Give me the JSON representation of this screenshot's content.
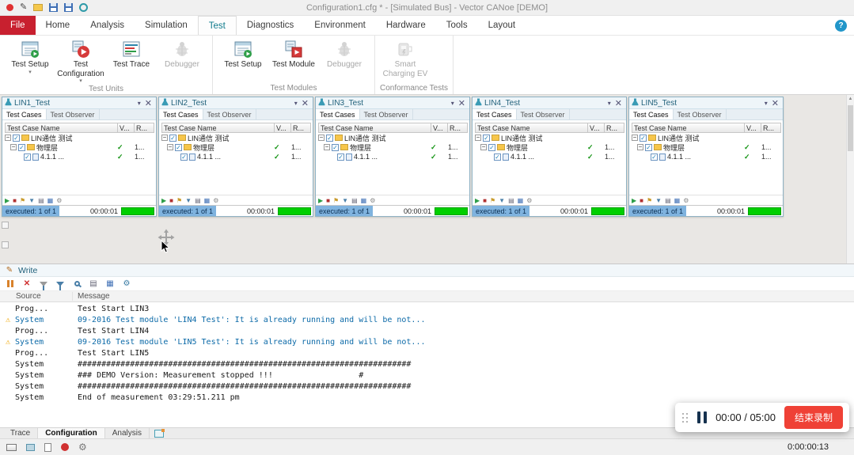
{
  "titlebar": {
    "title": "Configuration1.cfg * - [Simulated Bus] - Vector CANoe [DEMO]"
  },
  "menu": {
    "tabs": [
      "File",
      "Home",
      "Analysis",
      "Simulation",
      "Test",
      "Diagnostics",
      "Environment",
      "Hardware",
      "Tools",
      "Layout"
    ],
    "active": "Test",
    "help_label": "?"
  },
  "ribbon": {
    "groups": [
      {
        "label": "Test Units",
        "items": [
          {
            "label": "Test Setup",
            "dropdown": true,
            "enabled": true,
            "icon": "test-setup"
          },
          {
            "label": "Test Configuration",
            "dropdown": true,
            "enabled": true,
            "icon": "test-configuration"
          },
          {
            "label": "Test Trace",
            "dropdown": false,
            "enabled": true,
            "icon": "test-trace"
          },
          {
            "label": "Debugger",
            "dropdown": false,
            "enabled": false,
            "icon": "debugger"
          }
        ]
      },
      {
        "label": "Test Modules",
        "items": [
          {
            "label": "Test Setup",
            "dropdown": false,
            "enabled": true,
            "icon": "test-setup"
          },
          {
            "label": "Test Module",
            "dropdown": false,
            "enabled": true,
            "icon": "test-module"
          },
          {
            "label": "Debugger",
            "dropdown": false,
            "enabled": false,
            "icon": "debugger"
          }
        ]
      },
      {
        "label": "Conformance Tests",
        "items": [
          {
            "label": "Smart Charging EV",
            "dropdown": false,
            "enabled": false,
            "icon": "smart-charging"
          }
        ]
      }
    ]
  },
  "test_windows": [
    {
      "title": "LIN1_Test"
    },
    {
      "title": "LIN2_Test"
    },
    {
      "title": "LIN3_Test"
    },
    {
      "title": "LIN4_Test"
    },
    {
      "title": "LIN5_Test"
    }
  ],
  "test_window": {
    "tabs": [
      "Test Cases",
      "Test Observer"
    ],
    "active_tab": "Test Cases",
    "columns": [
      "Test Case Name",
      "V...",
      "R..."
    ],
    "rows": [
      {
        "name": "LIN通信 测试",
        "verdict": "",
        "result": "",
        "indent": 0,
        "expander": true,
        "checked": true,
        "icon": "folder"
      },
      {
        "name": "物理层",
        "verdict": "✓",
        "result": "1...",
        "indent": 1,
        "expander": true,
        "checked": true,
        "icon": "folder"
      },
      {
        "name": "4.1.1 ...",
        "verdict": "✓",
        "result": "1...",
        "indent": 2,
        "expander": false,
        "checked": true,
        "icon": "test-case"
      }
    ],
    "status": "executed: 1 of 1",
    "time": "00:00:01"
  },
  "write": {
    "title": "Write",
    "columns": [
      "Source",
      "Message"
    ],
    "rows": [
      {
        "source": "Prog...",
        "message": "Test Start LIN3",
        "level": "info"
      },
      {
        "source": "System",
        "message": "09-2016 Test module 'LIN4 Test': It is already running and will be not...",
        "level": "warning"
      },
      {
        "source": "Prog...",
        "message": "Test Start LIN4",
        "level": "info"
      },
      {
        "source": "System",
        "message": "09-2016 Test module 'LIN5 Test': It is already running and will be not...",
        "level": "warning"
      },
      {
        "source": "Prog...",
        "message": "Test Start LIN5",
        "level": "info"
      },
      {
        "source": "System",
        "message": "######################################################################",
        "level": "info"
      },
      {
        "source": "System",
        "message": "### DEMO Version: Measurement stopped !!!                  #",
        "level": "info"
      },
      {
        "source": "System",
        "message": "######################################################################",
        "level": "info"
      },
      {
        "source": "System",
        "message": "End of measurement 03:29:51.211 pm",
        "level": "info"
      }
    ]
  },
  "recording": {
    "time": "00:00 / 05:00",
    "stop_label": "结束录制"
  },
  "bottom_tabs": {
    "tabs": [
      "Trace",
      "Configuration",
      "Analysis"
    ],
    "active": "Configuration"
  },
  "statusbar": {
    "time": "0:00:00:13"
  }
}
